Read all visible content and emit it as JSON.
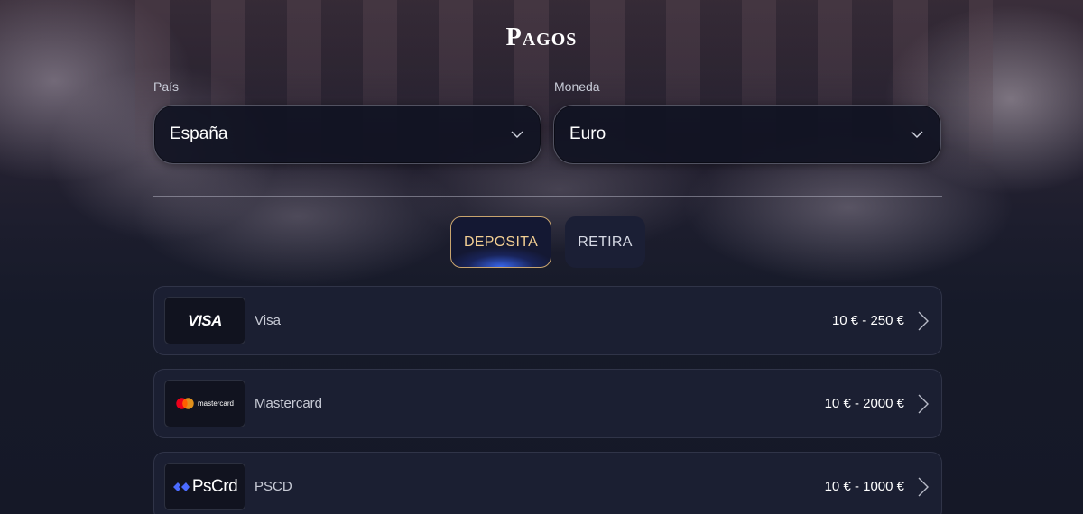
{
  "page": {
    "title": "Pagos"
  },
  "country": {
    "label": "País",
    "value": "España"
  },
  "currency": {
    "label": "Moneda",
    "value": "Euro"
  },
  "tabs": [
    {
      "label": "DEPOSITA",
      "active": true
    },
    {
      "label": "RETIRA",
      "active": false
    }
  ],
  "methods": [
    {
      "logo_text": "VISA",
      "name": "Visa",
      "limits": "10 € - 250 €",
      "logo_icon": "visa-logo"
    },
    {
      "logo_text": "mastercard",
      "name": "Mastercard",
      "limits": "10 € - 2000 €",
      "logo_icon": "mastercard-logo"
    },
    {
      "logo_text": "PsCrd",
      "name": "PSCD",
      "limits": "10 € - 1000 €",
      "logo_icon": "pscrd-logo"
    }
  ],
  "colors": {
    "accent_gold": "#c8a46e",
    "accent_blue": "#3c6eff",
    "background": "#151827",
    "row_background": "#1b1f32",
    "mastercard_red": "#eb001b",
    "mastercard_orange": "#f79e1b",
    "pscrd_blue": "#4b6bff"
  }
}
